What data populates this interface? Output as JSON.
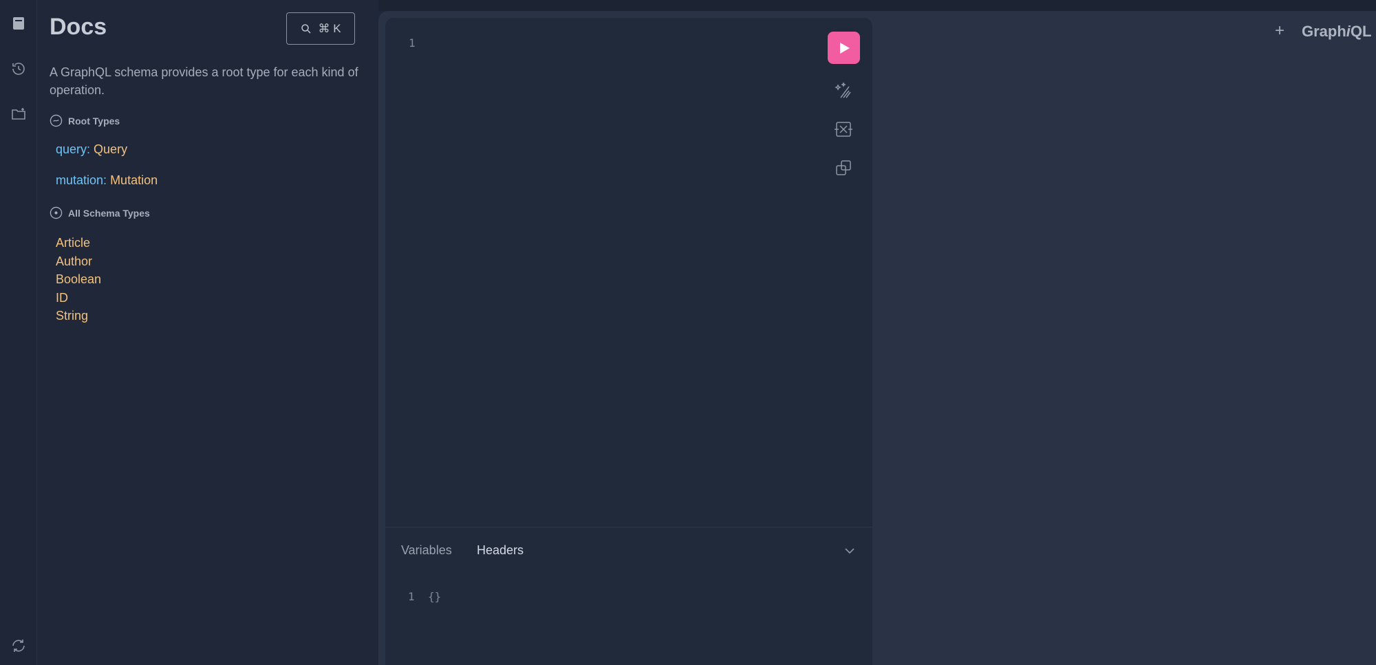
{
  "sidebar": {
    "items": [
      {
        "name": "docs-explorer",
        "icon": "book-icon"
      },
      {
        "name": "history",
        "icon": "history-icon"
      },
      {
        "name": "collections",
        "icon": "folder-plus-icon"
      },
      {
        "name": "refresh-schema",
        "icon": "refresh-icon"
      }
    ]
  },
  "docs": {
    "title": "Docs",
    "search_shortcut": "⌘ K",
    "description": "A GraphQL schema provides a root type for each kind of operation.",
    "root_types_heading": "Root Types",
    "root_types": [
      {
        "field": "query",
        "type": "Query"
      },
      {
        "field": "mutation",
        "type": "Mutation"
      }
    ],
    "all_types_heading": "All Schema Types",
    "all_types": [
      "Article",
      "Author",
      "Boolean",
      "ID",
      "String"
    ]
  },
  "editor": {
    "query_line": "1",
    "tabs": {
      "variables": "Variables",
      "headers": "Headers"
    },
    "variables_line": "1",
    "variables_content": "{}"
  },
  "header": {
    "plus": "+",
    "logo_prefix": "Graph",
    "logo_i": "i",
    "logo_suffix": "QL"
  },
  "colors": {
    "accent": "#f15da0",
    "field": "#6fc3f5",
    "type": "#f3c27d",
    "background": "#1f2739"
  }
}
